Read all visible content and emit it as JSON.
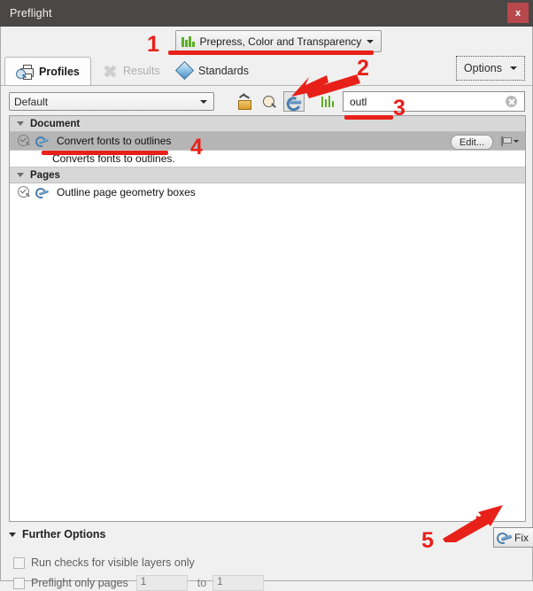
{
  "window": {
    "title": "Preflight",
    "close_label": "x"
  },
  "profile_button": {
    "label": "Prepress, Color and Transparency",
    "icon": "bars-chart-icon"
  },
  "tabs": [
    {
      "label": "Profiles",
      "icon": "printer-magnifier-icon",
      "state": "active"
    },
    {
      "label": "Results",
      "icon": "cross-icon",
      "state": "disabled"
    },
    {
      "label": "Standards",
      "icon": "diamond-icon",
      "state": "normal"
    }
  ],
  "options_button": {
    "label": "Options"
  },
  "toolbar": {
    "profile_combo_value": "Default",
    "buttons": [
      {
        "name": "wand-icon",
        "pressed": false
      },
      {
        "name": "magnifier-icon",
        "pressed": false
      },
      {
        "name": "wrench-icon",
        "pressed": true
      },
      {
        "name": "bars-chart-icon",
        "pressed": false
      }
    ],
    "search_value": "outl",
    "search_placeholder": "",
    "clear_icon": "clear-circle-icon"
  },
  "list": {
    "groups": [
      {
        "title": "Document",
        "rows": [
          {
            "label": "Convert fonts to outlines",
            "selected": true,
            "edit_label": "Edit...",
            "description": "Converts fonts to outlines."
          }
        ]
      },
      {
        "title": "Pages",
        "rows": [
          {
            "label": "Outline page geometry boxes",
            "selected": false
          }
        ]
      }
    ]
  },
  "further_options": {
    "title": "Further Options",
    "fix_label": "Fix",
    "checkbox_layers": {
      "label": "Run checks for visible layers only",
      "checked": false
    },
    "checkbox_pages": {
      "label": "Preflight only pages",
      "checked": false
    },
    "page_from": "1",
    "page_to_label": "to",
    "page_to": "1"
  },
  "annotations": [
    {
      "number": "1"
    },
    {
      "number": "2"
    },
    {
      "number": "3"
    },
    {
      "number": "4"
    },
    {
      "number": "5"
    }
  ],
  "colors": {
    "titlebar": "#4a4746",
    "close": "#b8484c",
    "accent_green": "#5cb026",
    "accent_blue": "#4a7fae",
    "annotation_red": "#e8201a",
    "selection": "#b5b5b5"
  }
}
